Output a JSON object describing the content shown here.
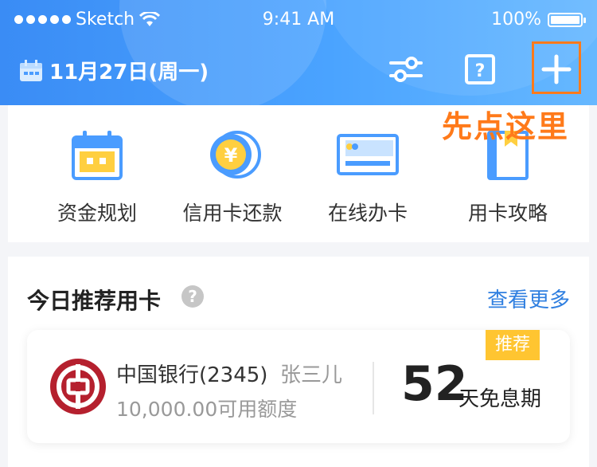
{
  "status": {
    "carrier": "Sketch",
    "time": "9:41 AM",
    "battery": "100%",
    "battery_level": 1.0
  },
  "header": {
    "date": "11月27日(周一)",
    "icons": [
      "calendar-icon",
      "sliders-icon",
      "help-square-icon",
      "plus-icon"
    ]
  },
  "hint": "先点这里",
  "actions": [
    {
      "label": "资金规划",
      "icon": "calendar-plan-icon"
    },
    {
      "label": "信用卡还款",
      "icon": "yen-coin-icon"
    },
    {
      "label": "在线办卡",
      "icon": "card-icon"
    },
    {
      "label": "用卡攻略",
      "icon": "bookmark-book-icon"
    }
  ],
  "recommend": {
    "title": "今日推荐用卡",
    "help": "?",
    "more": "查看更多",
    "card": {
      "bank": "中国银行(2345)",
      "owner": "张三儿",
      "limit": "10,000.00可用额度",
      "days": "52",
      "days_label": "天免息期",
      "badge": "推荐"
    }
  },
  "colors": {
    "header_start": "#3a8cf5",
    "header_end": "#66b8ff",
    "accent": "#2f7fe0",
    "hint": "#ff7a1a",
    "badge": "#ffc531",
    "bank_red": "#b5202e"
  }
}
